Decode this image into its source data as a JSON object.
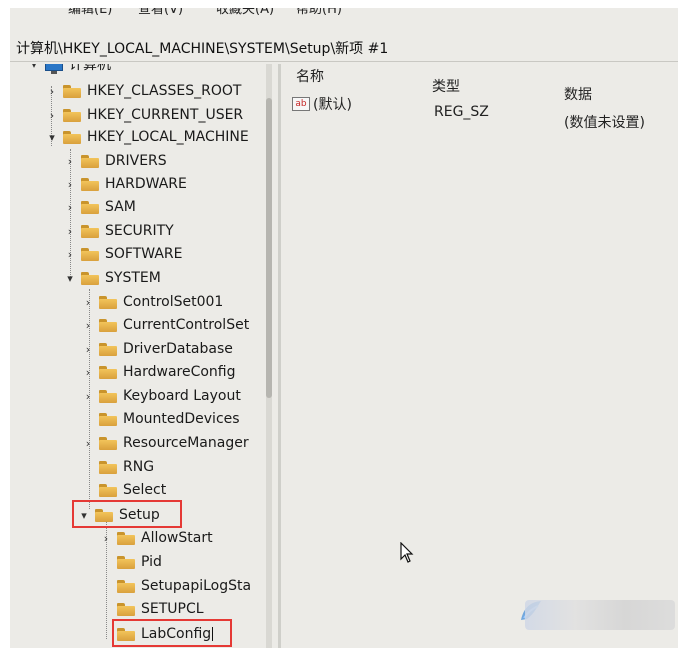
{
  "menubar": {
    "items": [
      "编辑(E)",
      "查看(V)",
      "收藏夹(A)",
      "帮助(H)"
    ]
  },
  "address": "计算机\\HKEY_LOCAL_MACHINE\\SYSTEM\\Setup\\新项 #1",
  "tree": {
    "root": "计算机",
    "hkcr": "HKEY_CLASSES_ROOT",
    "hkcu": "HKEY_CURRENT_USER",
    "hklm": "HKEY_LOCAL_MACHINE",
    "drivers": "DRIVERS",
    "hardware": "HARDWARE",
    "sam": "SAM",
    "security": "SECURITY",
    "software": "SOFTWARE",
    "system": "SYSTEM",
    "controlset001": "ControlSet001",
    "currentcontrolset": "CurrentControlSet",
    "driverdatabase": "DriverDatabase",
    "hardwareconfig": "HardwareConfig",
    "keyboardlayout": "Keyboard Layout",
    "mounteddevices": "MountedDevices",
    "resourcemanager": "ResourceManager",
    "rng": "RNG",
    "select": "Select",
    "setup": "Setup",
    "allowstart": "AllowStart",
    "pid": "Pid",
    "setupapilog": "SetupapiLogSta",
    "setupcl": "SETUPCL",
    "labconfig": "LabConfig"
  },
  "list": {
    "columns": {
      "name": "名称",
      "type": "类型",
      "data": "数据"
    },
    "rows": [
      {
        "name": "(默认)",
        "type": "REG_SZ",
        "data": "(数值未设置)",
        "icon": "ab-string-icon"
      }
    ]
  },
  "colors": {
    "highlight": "#e53935",
    "folder": "#f2c45a"
  }
}
